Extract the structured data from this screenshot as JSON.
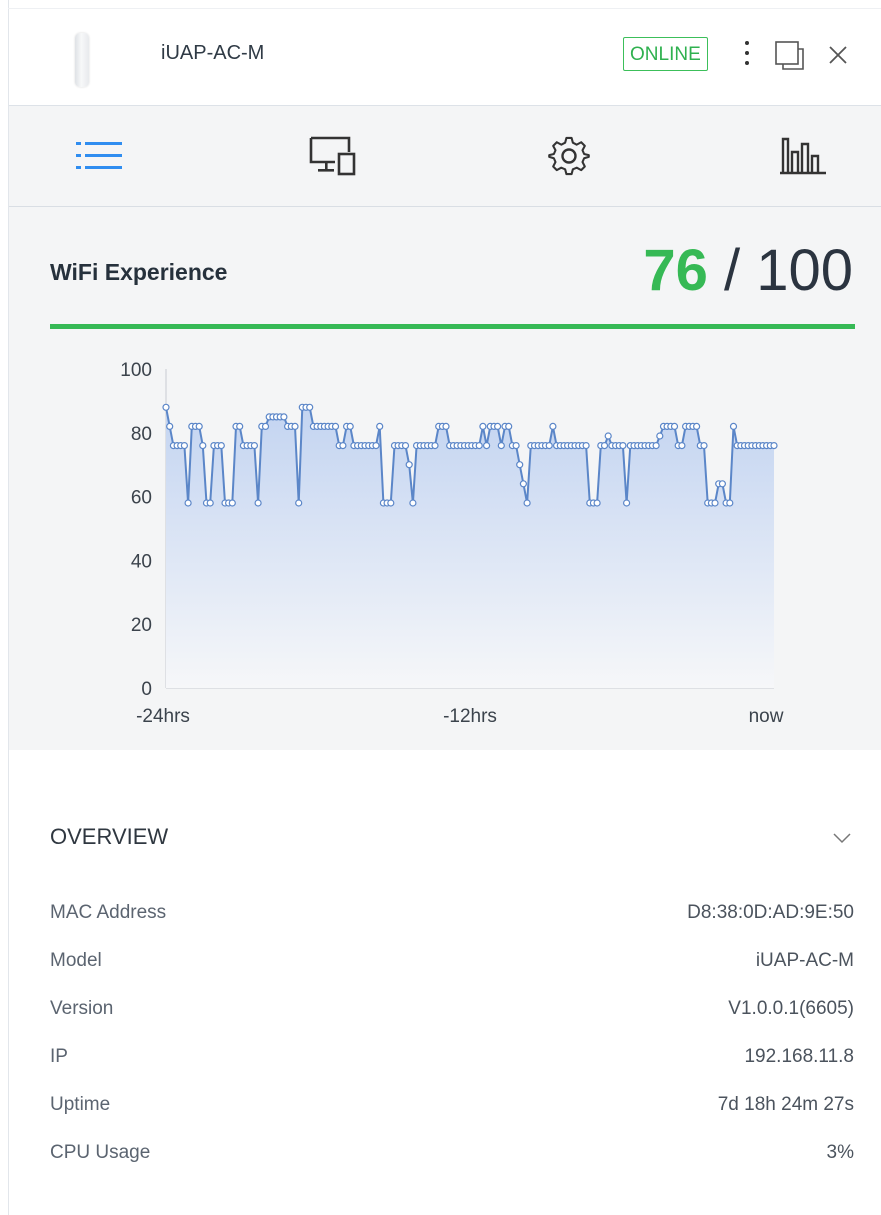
{
  "header": {
    "device_name": "iUAP-AC-M",
    "status": "ONLINE",
    "status_color": "#2fb14f"
  },
  "tabs": [
    {
      "name": "details",
      "icon": "list-icon",
      "active": true
    },
    {
      "name": "clients",
      "icon": "devices-icon",
      "active": false
    },
    {
      "name": "settings",
      "icon": "gear-icon",
      "active": false
    },
    {
      "name": "statistics",
      "icon": "bar-chart-icon",
      "active": false
    }
  ],
  "experience": {
    "title": "WiFi Experience",
    "score": "76",
    "score_max": "/ 100",
    "accent": "#36b955"
  },
  "chart_data": {
    "type": "area",
    "title": "",
    "xlabel": "",
    "ylabel": "",
    "ylim": [
      0,
      100
    ],
    "y_ticks": [
      "100",
      "80",
      "60",
      "40",
      "20",
      "0"
    ],
    "x_ticks": [
      "-24hrs",
      "-12hrs",
      "now"
    ],
    "series_color": "#5b86c8",
    "values": [
      88,
      82,
      76,
      76,
      76,
      76,
      58,
      82,
      82,
      82,
      76,
      58,
      58,
      76,
      76,
      76,
      58,
      58,
      58,
      82,
      82,
      76,
      76,
      76,
      76,
      58,
      82,
      82,
      85,
      85,
      85,
      85,
      85,
      82,
      82,
      82,
      58,
      88,
      88,
      88,
      82,
      82,
      82,
      82,
      82,
      82,
      82,
      76,
      76,
      82,
      82,
      76,
      76,
      76,
      76,
      76,
      76,
      76,
      82,
      58,
      58,
      58,
      76,
      76,
      76,
      76,
      70,
      58,
      76,
      76,
      76,
      76,
      76,
      76,
      82,
      82,
      82,
      76,
      76,
      76,
      76,
      76,
      76,
      76,
      76,
      76,
      82,
      76,
      82,
      82,
      82,
      76,
      82,
      82,
      76,
      76,
      70,
      64,
      58,
      76,
      76,
      76,
      76,
      76,
      76,
      82,
      76,
      76,
      76,
      76,
      76,
      76,
      76,
      76,
      76,
      58,
      58,
      58,
      76,
      76,
      79,
      76,
      76,
      76,
      76,
      58,
      76,
      76,
      76,
      76,
      76,
      76,
      76,
      76,
      79,
      82,
      82,
      82,
      82,
      76,
      76,
      82,
      82,
      82,
      82,
      76,
      76,
      58,
      58,
      58,
      64,
      64,
      58,
      58,
      82,
      76,
      76,
      76,
      76,
      76,
      76,
      76,
      76,
      76,
      76,
      76
    ]
  },
  "overview": {
    "title": "OVERVIEW",
    "rows": [
      {
        "label": "MAC Address",
        "value": "D8:38:0D:AD:9E:50"
      },
      {
        "label": "Model",
        "value": "iUAP-AC-M"
      },
      {
        "label": "Version",
        "value": "V1.0.0.1(6605)"
      },
      {
        "label": "IP",
        "value": "192.168.11.8"
      },
      {
        "label": "Uptime",
        "value": "7d 18h 24m 27s"
      },
      {
        "label": "CPU Usage",
        "value": "3%"
      }
    ]
  }
}
